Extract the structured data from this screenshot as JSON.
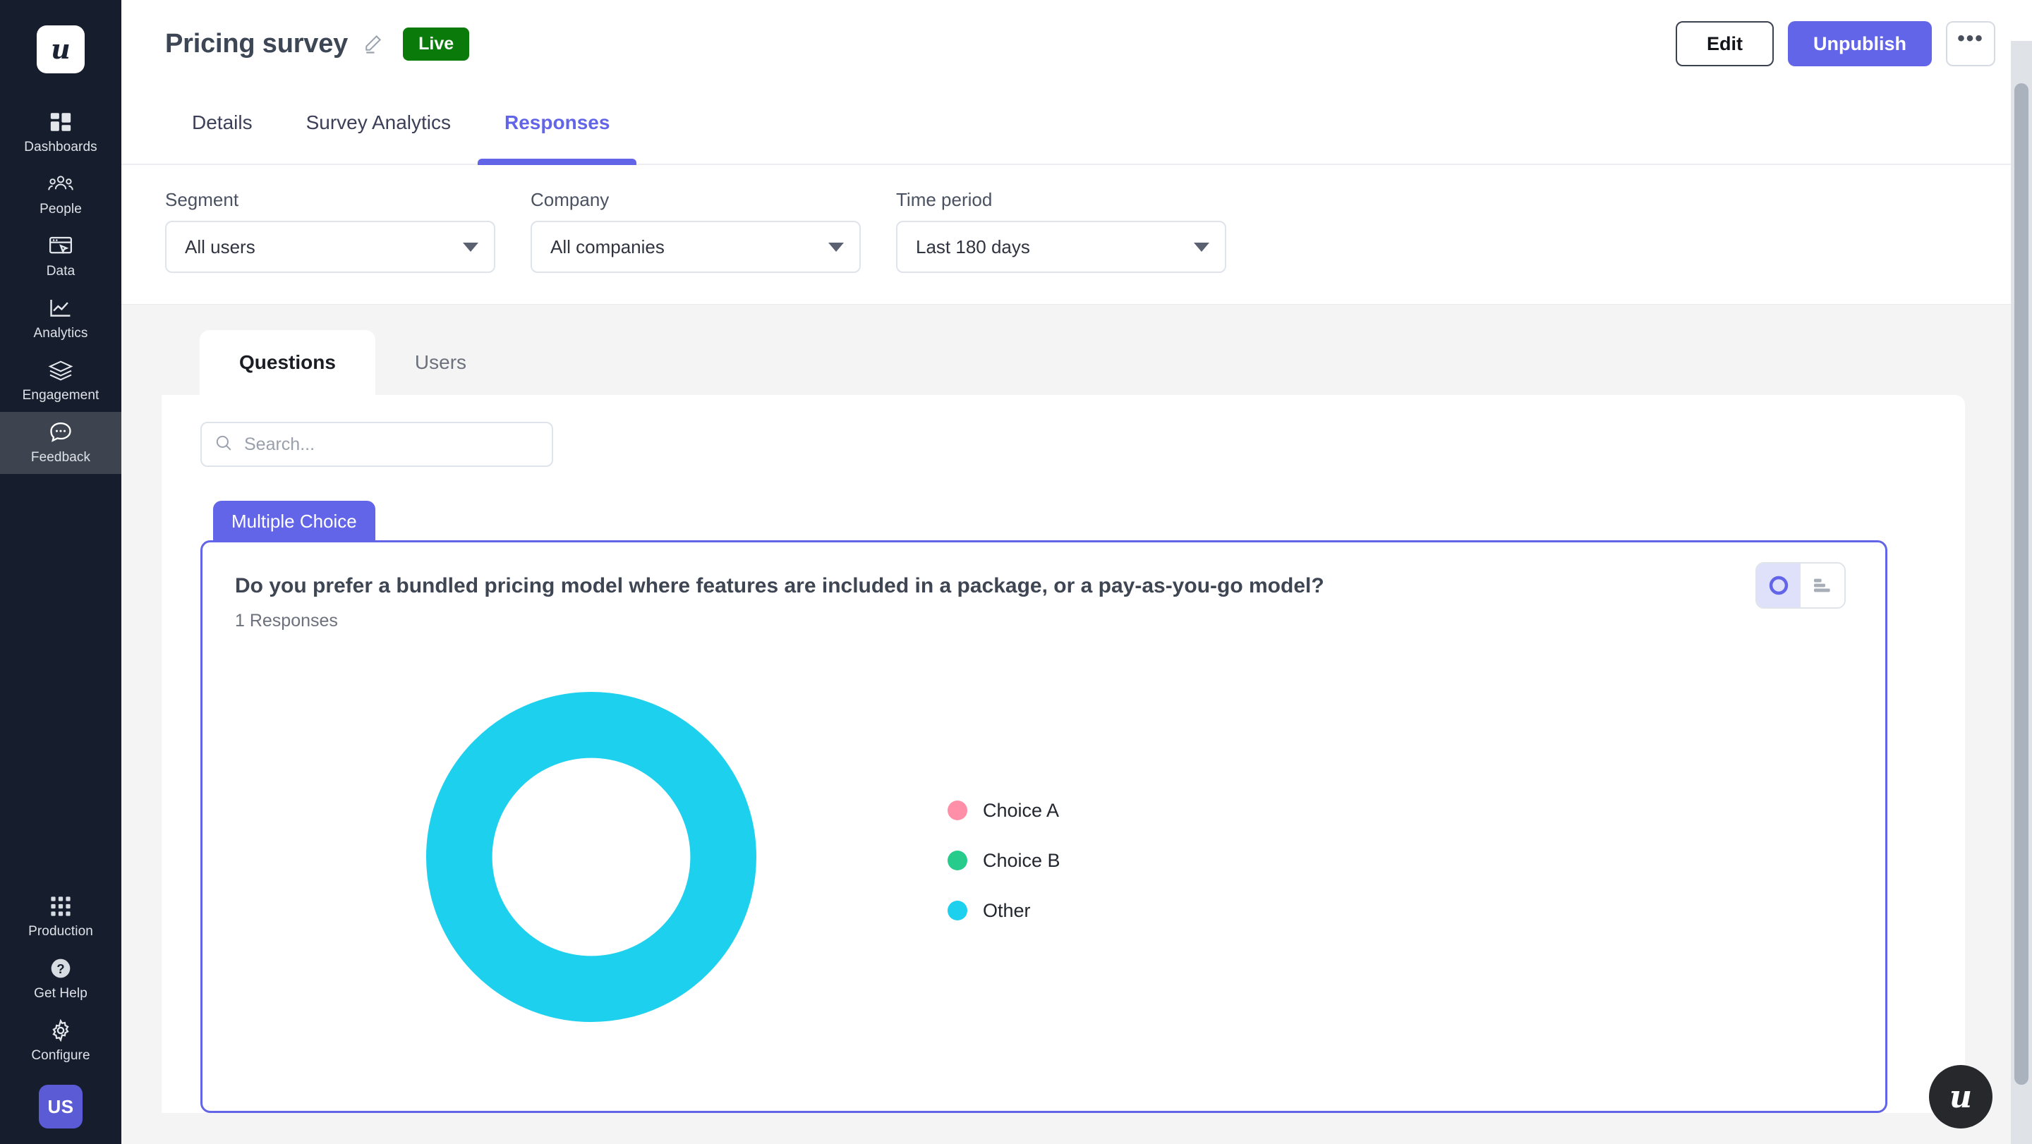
{
  "sidebar": {
    "logo": "u",
    "items": [
      {
        "label": "Dashboards",
        "icon": "dashboards-icon",
        "active": false
      },
      {
        "label": "People",
        "icon": "people-icon",
        "active": false
      },
      {
        "label": "Data",
        "icon": "data-icon",
        "active": false
      },
      {
        "label": "Analytics",
        "icon": "analytics-icon",
        "active": false
      },
      {
        "label": "Engagement",
        "icon": "engagement-icon",
        "active": false
      },
      {
        "label": "Feedback",
        "icon": "feedback-icon",
        "active": true
      }
    ],
    "bottom_items": [
      {
        "label": "Production",
        "icon": "grid-icon"
      },
      {
        "label": "Get Help",
        "icon": "question-mark-icon"
      },
      {
        "label": "Configure",
        "icon": "gear-icon"
      }
    ],
    "avatar": "US"
  },
  "header": {
    "title": "Pricing survey",
    "edit_title_icon": "pencil-icon",
    "status_badge": "Live",
    "status_color": "#0a7a0a",
    "edit_label": "Edit",
    "unpublish_label": "Unpublish",
    "more_label": "•••"
  },
  "nav_tabs": [
    {
      "label": "Details",
      "active": false
    },
    {
      "label": "Survey Analytics",
      "active": false
    },
    {
      "label": "Responses",
      "active": true
    }
  ],
  "filters": [
    {
      "label": "Segment",
      "value": "All users"
    },
    {
      "label": "Company",
      "value": "All companies"
    },
    {
      "label": "Time period",
      "value": "Last 180 days"
    }
  ],
  "panel_tabs": [
    {
      "label": "Questions",
      "active": true
    },
    {
      "label": "Users",
      "active": false
    }
  ],
  "search": {
    "value": "",
    "placeholder": "Search...",
    "icon": "search-icon"
  },
  "question": {
    "type_badge": "Multiple Choice",
    "text": "Do you prefer a bundled pricing model where features are included in a package, or a pay-as-you-go model?",
    "responses_count": "1 Responses",
    "view_toggle": [
      {
        "icon": "donut-chart-icon",
        "active": true
      },
      {
        "icon": "bar-chart-icon",
        "active": false
      }
    ]
  },
  "chart_data": {
    "type": "pie",
    "title": "Do you prefer a bundled pricing model where features are included in a package, or a pay-as-you-go model?",
    "subtitle": "1 Responses",
    "donut": true,
    "inner_radius_ratio": 0.6,
    "legend_position": "right",
    "categories": [
      "Choice A",
      "Choice B",
      "Other"
    ],
    "values": [
      0,
      0,
      100
    ],
    "unit": "%",
    "colors": [
      "#ff8fa8",
      "#27cb8b",
      "#1dd0ee"
    ],
    "total_responses": 1
  },
  "fab": {
    "label": "u"
  },
  "accent_color": "#6365e8"
}
